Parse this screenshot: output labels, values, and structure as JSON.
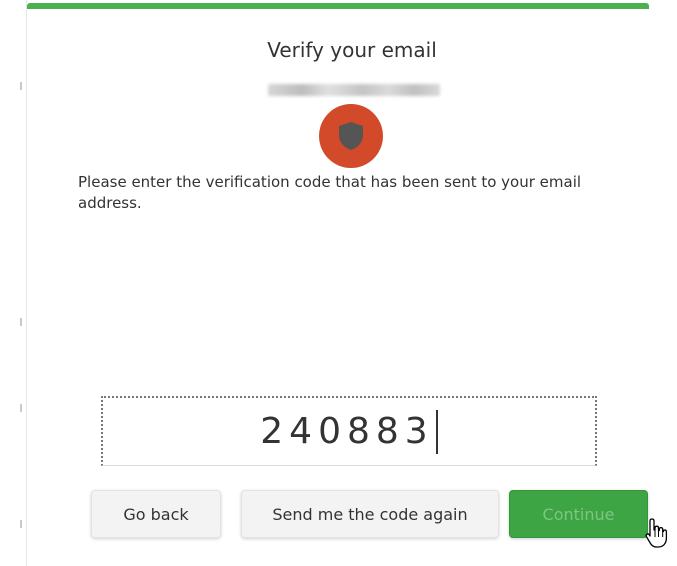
{
  "dialog": {
    "title": "Verify your email",
    "message": "Please enter the verification code that has been sent to your email address.",
    "accent_color": "#4caf50",
    "icon": {
      "name": "shield-icon",
      "circle_color": "#d24a2a"
    }
  },
  "code_input": {
    "value": "240883"
  },
  "buttons": {
    "back": "Go back",
    "resend": "Send me the code again",
    "continue": "Continue",
    "continue_color": "#3da543"
  }
}
